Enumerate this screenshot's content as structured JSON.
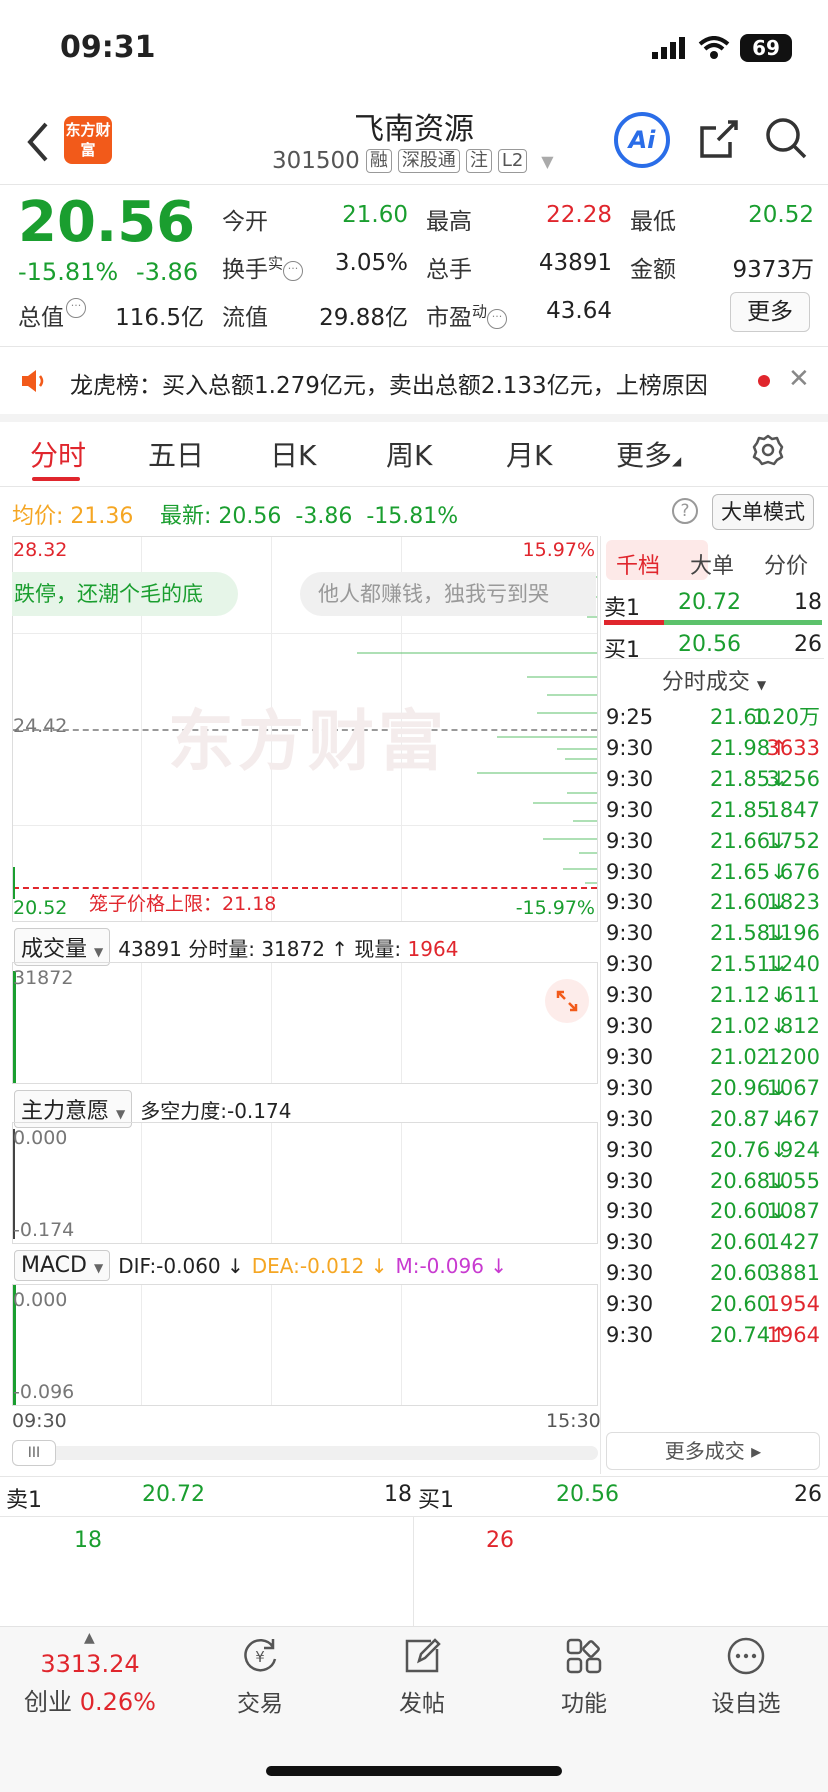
{
  "status": {
    "time": "09:31",
    "battery": "69"
  },
  "header": {
    "logo": "东方财富",
    "title": "飞南资源",
    "code": "301500",
    "tags": [
      "融",
      "深股通",
      "注",
      "L2"
    ],
    "ai": "Ai"
  },
  "quote": {
    "price": "20.56",
    "pct": "-15.81%",
    "change": "-3.86",
    "fields": [
      {
        "label": "今开",
        "value": "21.60"
      },
      {
        "label": "最高",
        "value": "22.28"
      },
      {
        "label": "最低",
        "value": "20.52"
      },
      {
        "label": "换手",
        "sup": "实",
        "value": "3.05%"
      },
      {
        "label": "总手",
        "value": "43891"
      },
      {
        "label": "金额",
        "value": "9373万"
      },
      {
        "label": "总值",
        "value": "116.5亿"
      },
      {
        "label": "流值",
        "value": "29.88亿"
      },
      {
        "label": "市盈",
        "sup": "动",
        "value": "43.64"
      }
    ],
    "more": "更多"
  },
  "notice": {
    "text": "龙虎榜：买入总额1.279亿元，卖出总额2.133亿元，上榜原因"
  },
  "tabs": [
    "分时",
    "五日",
    "日K",
    "周K",
    "月K",
    "更多"
  ],
  "info": {
    "avg_label": "均价:",
    "avg": "21.36",
    "latest_label": "最新:",
    "latest": "20.56",
    "chg": "-3.86",
    "pct": "-15.81%",
    "help": "?",
    "big_mode": "大单模式"
  },
  "chart": {
    "top_left": "28.32",
    "top_right": "15.97%",
    "mid_left": "24.42",
    "bottom_left": "20.52",
    "bottom_right": "-15.97%",
    "cage_label": "笼子价格上限：21.18",
    "bubble_left": "跌停，还潮个毛的底",
    "bubble_right": "他人都赚钱，独我亏到哭",
    "watermark": "东方财富"
  },
  "volume": {
    "selector": "成交量",
    "text": "43891 分时量: 31872 ↑ 现量: ",
    "now": "1964",
    "max": "31872"
  },
  "main_force": {
    "selector": "主力意愿",
    "text": "多空力度:-0.174",
    "top": "0.000",
    "bottom": "-0.174"
  },
  "macd": {
    "selector": "MACD",
    "dif": "DIF:-0.060 ↓",
    "dea": "DEA:-0.012 ↓",
    "m": "M:-0.096 ↓",
    "top": "0.000",
    "bottom": "-0.096"
  },
  "time_axis": {
    "start": "09:30",
    "end": "15:30"
  },
  "scroll_handle": "III",
  "orderbook": {
    "tabs": [
      "千档",
      "大单",
      "分价"
    ],
    "sell1": {
      "label": "卖1",
      "price": "20.72",
      "vol": "18"
    },
    "buy1": {
      "label": "买1",
      "price": "20.56",
      "vol": "26"
    },
    "trades_title": "分时成交",
    "trades": [
      {
        "t": "9:25",
        "p": "21.60",
        "a": "",
        "v": "1.20万",
        "vc": "g"
      },
      {
        "t": "9:30",
        "p": "21.98",
        "a": "↑",
        "v": "3633",
        "vc": "r"
      },
      {
        "t": "9:30",
        "p": "21.85",
        "a": "↓",
        "v": "3256",
        "vc": "g"
      },
      {
        "t": "9:30",
        "p": "21.85",
        "a": "",
        "v": "1847",
        "vc": "g"
      },
      {
        "t": "9:30",
        "p": "21.66",
        "a": "↓",
        "v": "1752",
        "vc": "g"
      },
      {
        "t": "9:30",
        "p": "21.65",
        "a": "↓",
        "v": "676",
        "vc": "g"
      },
      {
        "t": "9:30",
        "p": "21.60",
        "a": "↓",
        "v": "1823",
        "vc": "g"
      },
      {
        "t": "9:30",
        "p": "21.58",
        "a": "↓",
        "v": "1196",
        "vc": "g"
      },
      {
        "t": "9:30",
        "p": "21.51",
        "a": "↓",
        "v": "1240",
        "vc": "g"
      },
      {
        "t": "9:30",
        "p": "21.12",
        "a": "↓",
        "v": "611",
        "vc": "g"
      },
      {
        "t": "9:30",
        "p": "21.02",
        "a": "↓",
        "v": "812",
        "vc": "g"
      },
      {
        "t": "9:30",
        "p": "21.02",
        "a": "",
        "v": "1200",
        "vc": "g"
      },
      {
        "t": "9:30",
        "p": "20.96",
        "a": "↓",
        "v": "1067",
        "vc": "g"
      },
      {
        "t": "9:30",
        "p": "20.87",
        "a": "↓",
        "v": "467",
        "vc": "g"
      },
      {
        "t": "9:30",
        "p": "20.76",
        "a": "↓",
        "v": "924",
        "vc": "g"
      },
      {
        "t": "9:30",
        "p": "20.68",
        "a": "↓",
        "v": "1055",
        "vc": "g"
      },
      {
        "t": "9:30",
        "p": "20.60",
        "a": "↓",
        "v": "1087",
        "vc": "g"
      },
      {
        "t": "9:30",
        "p": "20.60",
        "a": "",
        "v": "1427",
        "vc": "g"
      },
      {
        "t": "9:30",
        "p": "20.60",
        "a": "",
        "v": "3881",
        "vc": "g"
      },
      {
        "t": "9:30",
        "p": "20.60",
        "a": "",
        "v": "1954",
        "vc": "r"
      },
      {
        "t": "9:30",
        "p": "20.74",
        "a": "↑",
        "v": "1964",
        "vc": "r"
      }
    ],
    "more": "更多成交 ▸"
  },
  "bottom_book": {
    "sell_label": "卖1",
    "sell_price": "20.72",
    "sell_vol": "18",
    "sell_detail": "18",
    "buy_label": "买1",
    "buy_price": "20.56",
    "buy_vol": "26",
    "buy_detail": "26"
  },
  "tabbar": {
    "index_value": "3313.24",
    "index_name": "创业",
    "index_pct": "0.26%",
    "items": [
      "交易",
      "发帖",
      "功能",
      "设自选"
    ]
  },
  "colors": {
    "up": "#e0262d",
    "down": "#1a9e2f",
    "avg": "#f5a623",
    "accent": "#2a6de8"
  }
}
